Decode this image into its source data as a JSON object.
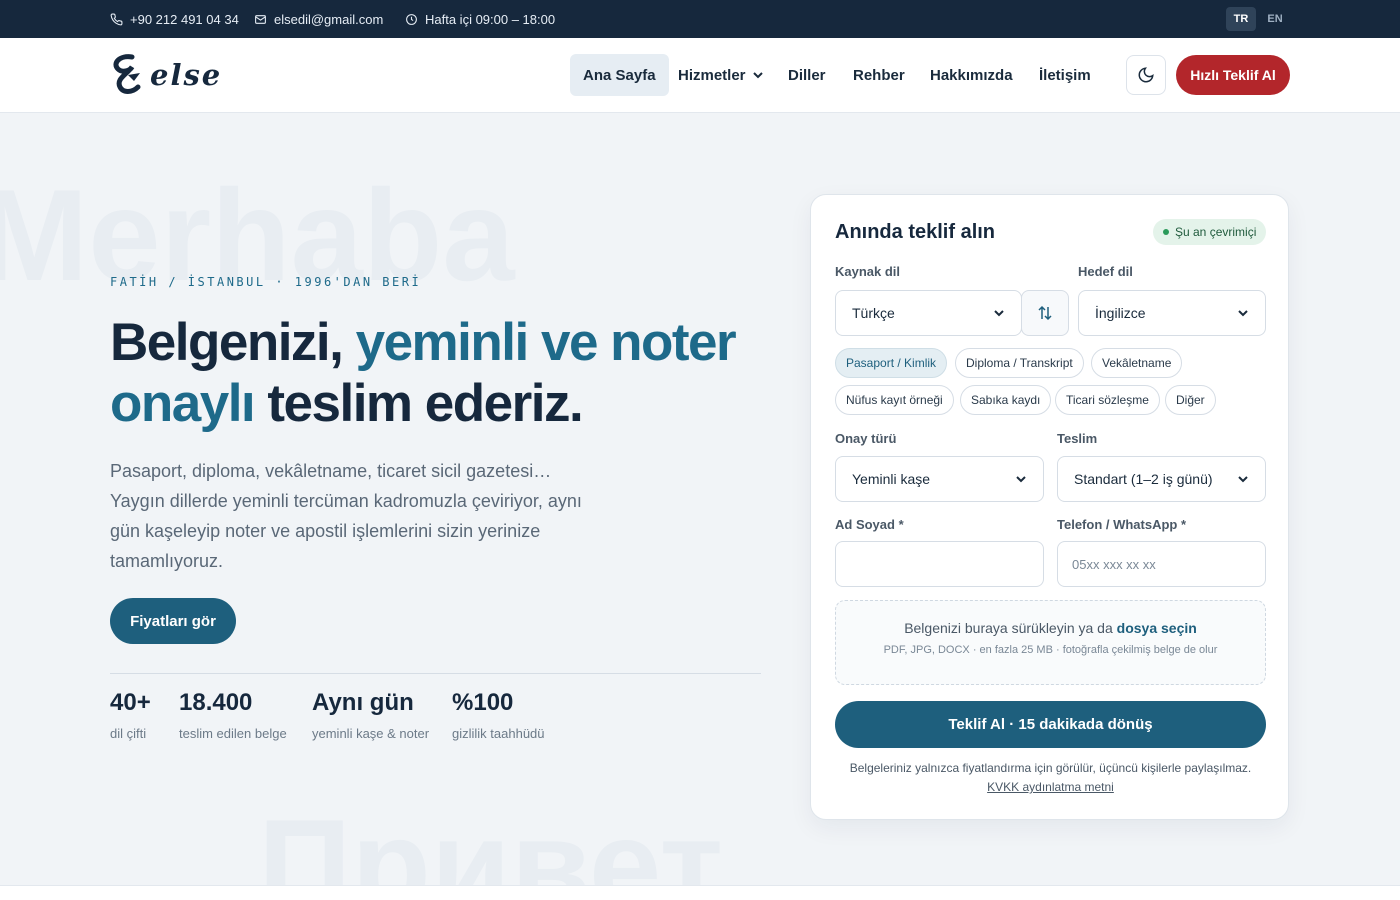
{
  "topbar": {
    "phone": "+90 212 491 04 34",
    "email": "elsedil@gmail.com",
    "hours": "Hafta içi 09:00 – 18:00",
    "languages": [
      "TR",
      "EN"
    ],
    "active_language": "TR"
  },
  "header": {
    "logo": "else",
    "nav": [
      "Ana Sayfa",
      "Hizmetler",
      "Diller",
      "Rehber",
      "Hakkımızda",
      "İletişim"
    ],
    "active_nav": "Ana Sayfa",
    "quote_button": "Hızlı Teklif Al"
  },
  "hero": {
    "watermarks": [
      "Merhaba",
      "Привет"
    ],
    "eyebrow": "FATİH / İSTANBUL · 1996'DAN BERİ",
    "headline_part1": "Belgenizi, ",
    "headline_accent": "yeminli ve noter onaylı",
    "headline_part2": " teslim ederiz.",
    "lead": "Pasaport, diploma, vekâletname, ticaret sicil gazetesi… Yaygın dillerde yeminli tercüman kadromuzla çeviriyor, aynı gün kaşeleyip noter ve apostil işlemlerini sizin yerinize tamamlıyoruz.",
    "cta": "Fiyatları gör",
    "stats": [
      {
        "num": "40+",
        "label": "dil çifti"
      },
      {
        "num": "18.400",
        "label": "teslim edilen belge"
      },
      {
        "num": "Aynı gün",
        "label": "yeminli kaşe & noter"
      },
      {
        "num": "%100",
        "label": "gizlilik taahhüdü"
      }
    ]
  },
  "form": {
    "title": "Anında teklif alın",
    "status": "Şu an çevrimiçi",
    "source_label": "Kaynak dil",
    "source_value": "Türkçe",
    "target_label": "Hedef dil",
    "target_value": "İngilizce",
    "doc_types": [
      "Pasaport / Kimlik",
      "Diploma / Transkript",
      "Vekâletname",
      "Nüfus kayıt örneği",
      "Sabıka kaydı",
      "Ticari sözleşme",
      "Diğer"
    ],
    "active_doc_type": "Pasaport / Kimlik",
    "approval_label": "Onay türü",
    "approval_value": "Yeminli kaşe",
    "delivery_label": "Teslim",
    "delivery_value": "Standart (1–2 iş günü)",
    "name_label": "Ad Soyad *",
    "name_value": "",
    "phone_label": "Telefon / WhatsApp *",
    "phone_placeholder": "05xx xxx xx xx",
    "upload_text": "Belgenizi buraya sürükleyin ya da ",
    "upload_link": "dosya seçin",
    "upload_hint": "PDF, JPG, DOCX · en fazla 25 MB · fotoğrafla çekilmiş belge de olur",
    "submit": "Teklif Al · 15 dakikada dönüş",
    "privacy_note": "Belgeleriniz yalnızca fiyatlandırma için görülür, üçüncü kişilerle paylaşılmaz.",
    "kvkk_link": "KVKK aydınlatma metni"
  },
  "colors": {
    "navy": "#16283d",
    "accent": "#1e6a8a",
    "primary_button": "#1e5f7d",
    "quote_red": "#b3262b",
    "online_green": "#2a9a5a"
  }
}
